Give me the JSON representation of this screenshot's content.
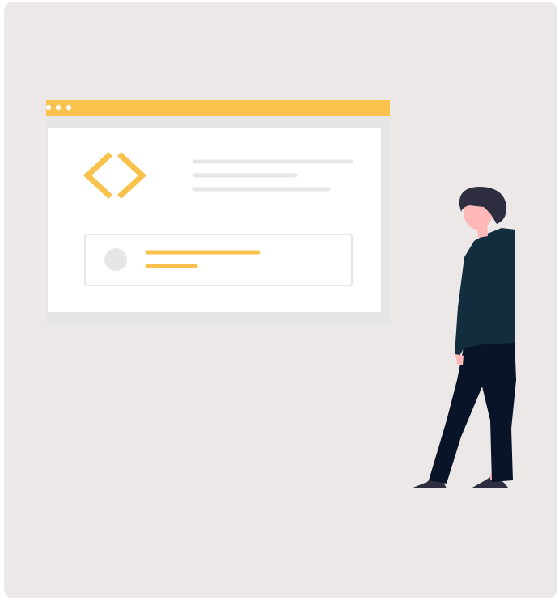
{
  "colors": {
    "card_background": "#ece8e7",
    "accent": "#f8c24c",
    "window_frame": "#e6e6e6",
    "window_body": "#ffffff",
    "placeholder_grey": "#e6e6e6",
    "person_hoodie": "#122d3e",
    "person_pants": "#0a1428",
    "person_hair": "#2f2e41",
    "person_skin": "#ffb8b8"
  },
  "icons": {
    "code_symbol": "code-brackets-icon",
    "window_controls": "dots-icon",
    "avatar_placeholder": "circle-placeholder-icon"
  }
}
